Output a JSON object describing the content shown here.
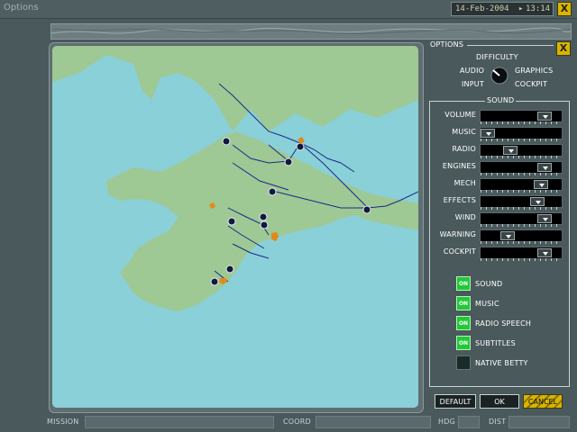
{
  "window": {
    "title": "Options",
    "date": "14-Feb-2004",
    "time": "13:14",
    "close_label": "X"
  },
  "options": {
    "header": "OPTIONS",
    "close_label": "X",
    "categories": {
      "difficulty": "DIFFICULTY",
      "audio": "AUDIO",
      "graphics": "GRAPHICS",
      "input": "INPUT",
      "cockpit": "COCKPIT"
    },
    "sound_header": "SOUND",
    "sliders": [
      {
        "label": "VOLUME",
        "level": 0.88
      },
      {
        "label": "MUSIC",
        "level": 0.0
      },
      {
        "label": "RADIO",
        "level": 0.35
      },
      {
        "label": "ENGINES",
        "level": 0.88
      },
      {
        "label": "MECH",
        "level": 0.82
      },
      {
        "label": "EFFECTS",
        "level": 0.76
      },
      {
        "label": "WIND",
        "level": 0.88
      },
      {
        "label": "WARNING",
        "level": 0.3
      },
      {
        "label": "COCKPIT",
        "level": 0.88
      }
    ],
    "toggles": [
      {
        "label": "SOUND",
        "on": true,
        "badge": "ON"
      },
      {
        "label": "MUSIC",
        "on": true,
        "badge": "ON"
      },
      {
        "label": "RADIO SPEECH",
        "on": true,
        "badge": "ON"
      },
      {
        "label": "SUBTITLES",
        "on": true,
        "badge": "ON"
      },
      {
        "label": "NATIVE BETTY",
        "on": false,
        "badge": ""
      }
    ],
    "buttons": {
      "default": "DEFAULT",
      "ok": "OK",
      "cancel": "CANCEL"
    }
  },
  "statusbar": {
    "mission": "MISSION",
    "coord": "COORD",
    "hdg": "HDG",
    "dist": "DIST"
  },
  "colors": {
    "sea": "#8ad0d8",
    "land": "#9ec894",
    "route": "#1a2a8a",
    "ally": "#e08a1a",
    "highlight": "#d9b400"
  }
}
